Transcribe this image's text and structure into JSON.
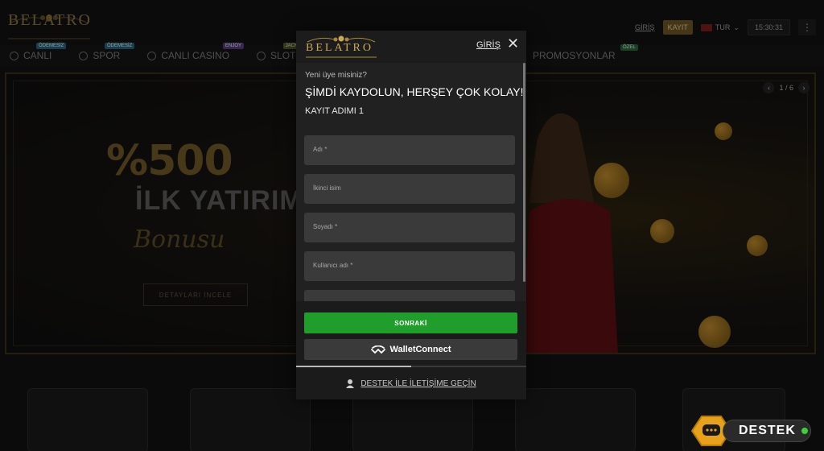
{
  "header": {
    "logo_text": "BELATRO",
    "login_link": "GİRİŞ",
    "register_button": "KAYIT",
    "language": "TUR",
    "time": "15:30:31",
    "menu_icon": "⋮"
  },
  "nav": {
    "items": [
      {
        "label": "CANLI",
        "badge": "ÖDEMESİZ"
      },
      {
        "label": "SPOR",
        "badge": "ÖDEMESİZ"
      },
      {
        "label": "CANLI CASINO",
        "badge": "ENJOY"
      },
      {
        "label": "SLOT",
        "badge": "JACKPOT"
      }
    ],
    "promos_label": "PROMOSYONLAR",
    "promos_badge": "ÖZEL"
  },
  "banner": {
    "percent": "%500",
    "headline": "İLK YATIRIM",
    "script": "Bonusu",
    "details_button": "DETAYLARI İNCELE",
    "pager": "1 / 6"
  },
  "modal": {
    "logo_text": "BELATRO",
    "login_link": "GİRİŞ",
    "close_icon": "✕",
    "question": "Yeni üye misiniz?",
    "title": "ŞİMDİ KAYDOLUN, HERŞEY ÇOK KOLAY!",
    "step_label": "KAYIT ADIMI 1",
    "fields": [
      {
        "placeholder": "Adı *"
      },
      {
        "placeholder": "İkinci isim"
      },
      {
        "placeholder": "Soyadı *"
      },
      {
        "placeholder": "Kullanıcı adı *"
      },
      {
        "placeholder": ""
      }
    ],
    "next_button": "SONRAKİ",
    "walletconnect_button": "WalletConnect",
    "support_link": "DESTEK İLE İLETİŞİME GEÇİN",
    "step_progress": 0.5
  },
  "floating": {
    "support_label": "DESTEK"
  },
  "colors": {
    "accent_gold": "#c9a857",
    "next_green": "#1f9e2c",
    "status_online": "#3ad13a"
  }
}
